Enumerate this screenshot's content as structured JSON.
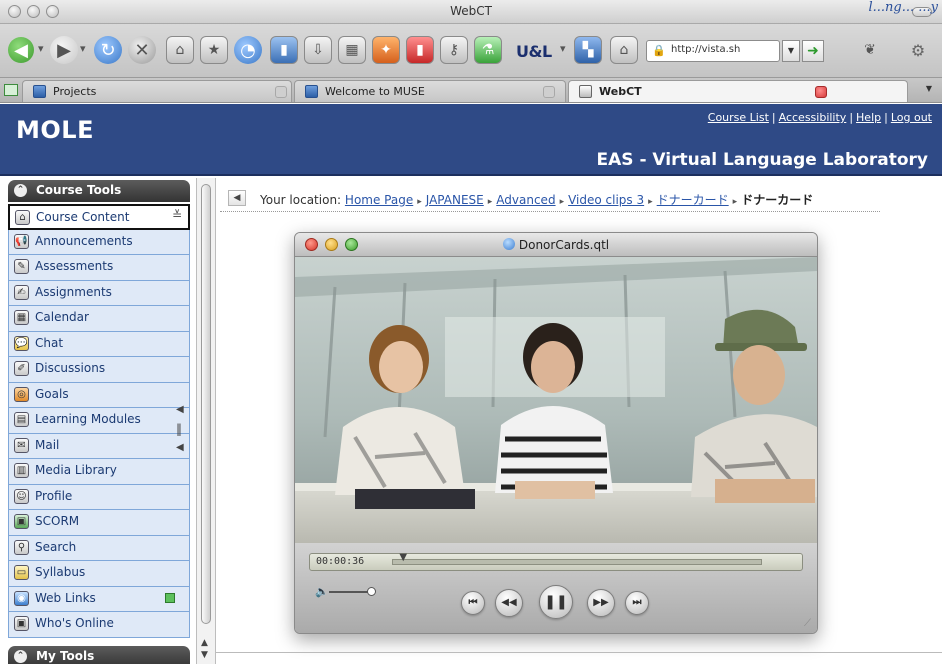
{
  "corner_caption": "l...ng... ...y",
  "window": {
    "title": "WebCT"
  },
  "toolbar": {
    "ua_label": "U&L",
    "url": "http://vista.sh",
    "icons": [
      "back-icon",
      "forward-icon",
      "reload-icon",
      "stop-icon",
      "home-icon",
      "bookmark-icon",
      "history-icon",
      "book-icon",
      "download-icon",
      "calendar-icon",
      "tools-icon",
      "note-icon",
      "key-icon",
      "flask-icon",
      "ua-icon",
      "tag-icon",
      "lock-icon",
      "go-icon",
      "dropdown-icon",
      "settings-icon"
    ]
  },
  "tabs": [
    {
      "label": "Projects",
      "active": false
    },
    {
      "label": "Welcome to MUSE",
      "active": false
    },
    {
      "label": "WebCT",
      "active": true
    }
  ],
  "header": {
    "logo": "MOLE",
    "links": [
      "Course List",
      "Accessibility",
      "Help",
      "Log out"
    ],
    "course_title": "EAS - Virtual Language Laboratory"
  },
  "sidebar": {
    "course_tools_label": "Course Tools",
    "my_tools_label": "My Tools",
    "items": [
      {
        "label": "Course Content",
        "icon": "course-content-icon"
      },
      {
        "label": "Announcements",
        "icon": "announcements-icon"
      },
      {
        "label": "Assessments",
        "icon": "assessments-icon"
      },
      {
        "label": "Assignments",
        "icon": "assignments-icon"
      },
      {
        "label": "Calendar",
        "icon": "calendar-icon"
      },
      {
        "label": "Chat",
        "icon": "chat-icon"
      },
      {
        "label": "Discussions",
        "icon": "discussions-icon"
      },
      {
        "label": "Goals",
        "icon": "goals-icon"
      },
      {
        "label": "Learning Modules",
        "icon": "learning-modules-icon"
      },
      {
        "label": "Mail",
        "icon": "mail-icon"
      },
      {
        "label": "Media Library",
        "icon": "media-library-icon"
      },
      {
        "label": "Profile",
        "icon": "profile-icon"
      },
      {
        "label": "SCORM",
        "icon": "scorm-icon"
      },
      {
        "label": "Search",
        "icon": "search-icon"
      },
      {
        "label": "Syllabus",
        "icon": "syllabus-icon"
      },
      {
        "label": "Web Links",
        "icon": "web-links-icon"
      },
      {
        "label": "Who's Online",
        "icon": "whos-online-icon"
      }
    ]
  },
  "breadcrumb": {
    "prefix": "Your location:",
    "links": [
      "Home Page",
      "JAPANESE",
      "Advanced",
      "Video clips 3",
      "ドナーカード"
    ],
    "current": "ドナーカード"
  },
  "player": {
    "title": "DonorCards.qtl",
    "time": "00:00:36",
    "progress_fraction": 0.02
  },
  "colors": {
    "banner": "#2f4a86",
    "link": "#2a55a8",
    "sidebar_item_bg": "#dfe9f7",
    "sidebar_item_border": "#7fa7d9"
  }
}
